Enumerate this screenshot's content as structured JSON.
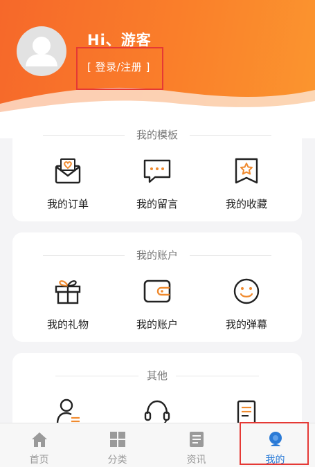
{
  "header": {
    "greeting": "Hi、游客",
    "login_link": "[ 登录/注册 ]"
  },
  "sections": [
    {
      "title": "我的模板",
      "items": [
        {
          "label": "我的订单",
          "icon": "envelope-heart-icon"
        },
        {
          "label": "我的留言",
          "icon": "chat-bubble-icon"
        },
        {
          "label": "我的收藏",
          "icon": "bookmark-star-icon"
        }
      ]
    },
    {
      "title": "我的账户",
      "items": [
        {
          "label": "我的礼物",
          "icon": "gift-icon"
        },
        {
          "label": "我的账户",
          "icon": "wallet-icon"
        },
        {
          "label": "我的弹幕",
          "icon": "smiley-icon"
        }
      ]
    },
    {
      "title": "其他",
      "items": [
        {
          "label": "",
          "icon": "user-list-icon"
        },
        {
          "label": "",
          "icon": "headset-icon"
        },
        {
          "label": "",
          "icon": "document-icon"
        }
      ]
    }
  ],
  "tabbar": {
    "tabs": [
      {
        "label": "首页",
        "icon": "home-icon"
      },
      {
        "label": "分类",
        "icon": "grid-icon"
      },
      {
        "label": "资讯",
        "icon": "news-icon"
      },
      {
        "label": "我的",
        "icon": "profile-icon"
      }
    ],
    "active_index": 3
  },
  "colors": {
    "accent_orange": "#f6682a",
    "icon_orange": "#f08a2e",
    "active_blue": "#2a7ad6",
    "annotation_red": "#e53935"
  }
}
